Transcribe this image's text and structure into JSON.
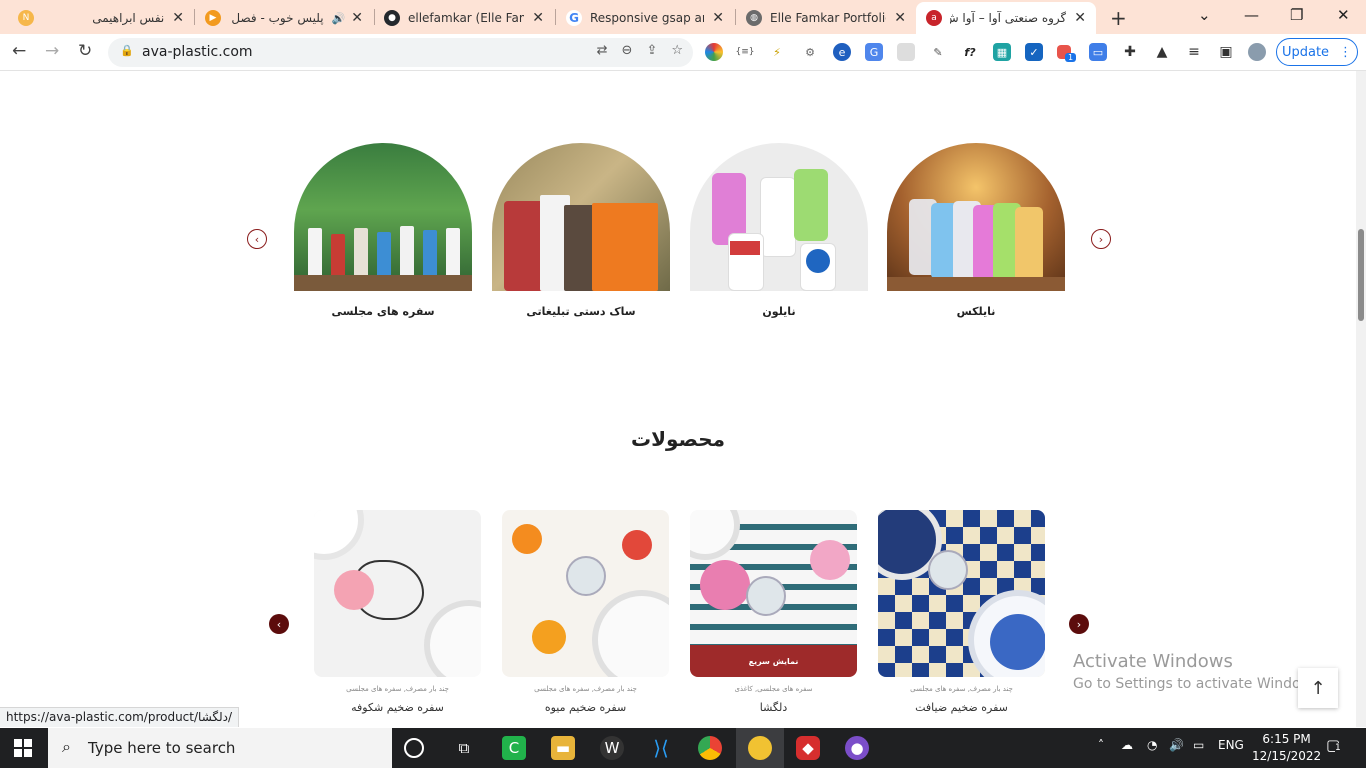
{
  "tabs": [
    {
      "title": "نفس ابراهیمی",
      "favicon": "ne-favicon",
      "fav_color": "#f6b74a"
    },
    {
      "title": "پلیس خوب - فصل",
      "favicon": "play-favicon",
      "fav_color": "#f29a1f",
      "extra_icon": "speaker-icon"
    },
    {
      "title": "ellefamkar (Elle Famkar",
      "favicon": "github-favicon",
      "fav_color": "#24292e"
    },
    {
      "title": "Responsive gsap anim",
      "favicon": "google-favicon",
      "fav_color": "#4285f4"
    },
    {
      "title": "Elle Famkar Portfolio",
      "favicon": "globe-favicon",
      "fav_color": "#6b6b6b"
    },
    {
      "title": "گروه صنعتی آوا – آوا ش",
      "favicon": "ava-favicon",
      "fav_color": "#c8242b",
      "active": true
    }
  ],
  "address": {
    "url": "ava-plastic.com"
  },
  "update_label": "Update",
  "extensions_badge": "1",
  "categories": [
    {
      "label": "سفره های مجلسی"
    },
    {
      "label": "ساک دستی تبلیغاتی"
    },
    {
      "label": "نایلون"
    },
    {
      "label": "نایلکس"
    }
  ],
  "products_title": "محصولات",
  "products": [
    {
      "name": "سفره ضخیم شکوفه",
      "cats": "چند بار مصرف, سفره های مجلسی"
    },
    {
      "name": "سفره ضخیم میوه",
      "cats": "چند بار مصرف, سفره های مجلسی"
    },
    {
      "name": "دلگشا",
      "cats": "سفره های مجلسی, کاغذی",
      "quick_view": "نمایش سریع"
    },
    {
      "name": "سفره ضخیم ضیافت",
      "cats": "چند بار مصرف, سفره های مجلسی"
    }
  ],
  "watermark": {
    "line1": "Activate Windows",
    "line2": "Go to Settings to activate Windows."
  },
  "status_url": "https://ava-plastic.com/product/دلگشا/",
  "taskbar": {
    "search_placeholder": "Type here to search",
    "language": "ENG",
    "time": "6:15 PM",
    "date": "12/15/2022",
    "notification_count": "1"
  }
}
